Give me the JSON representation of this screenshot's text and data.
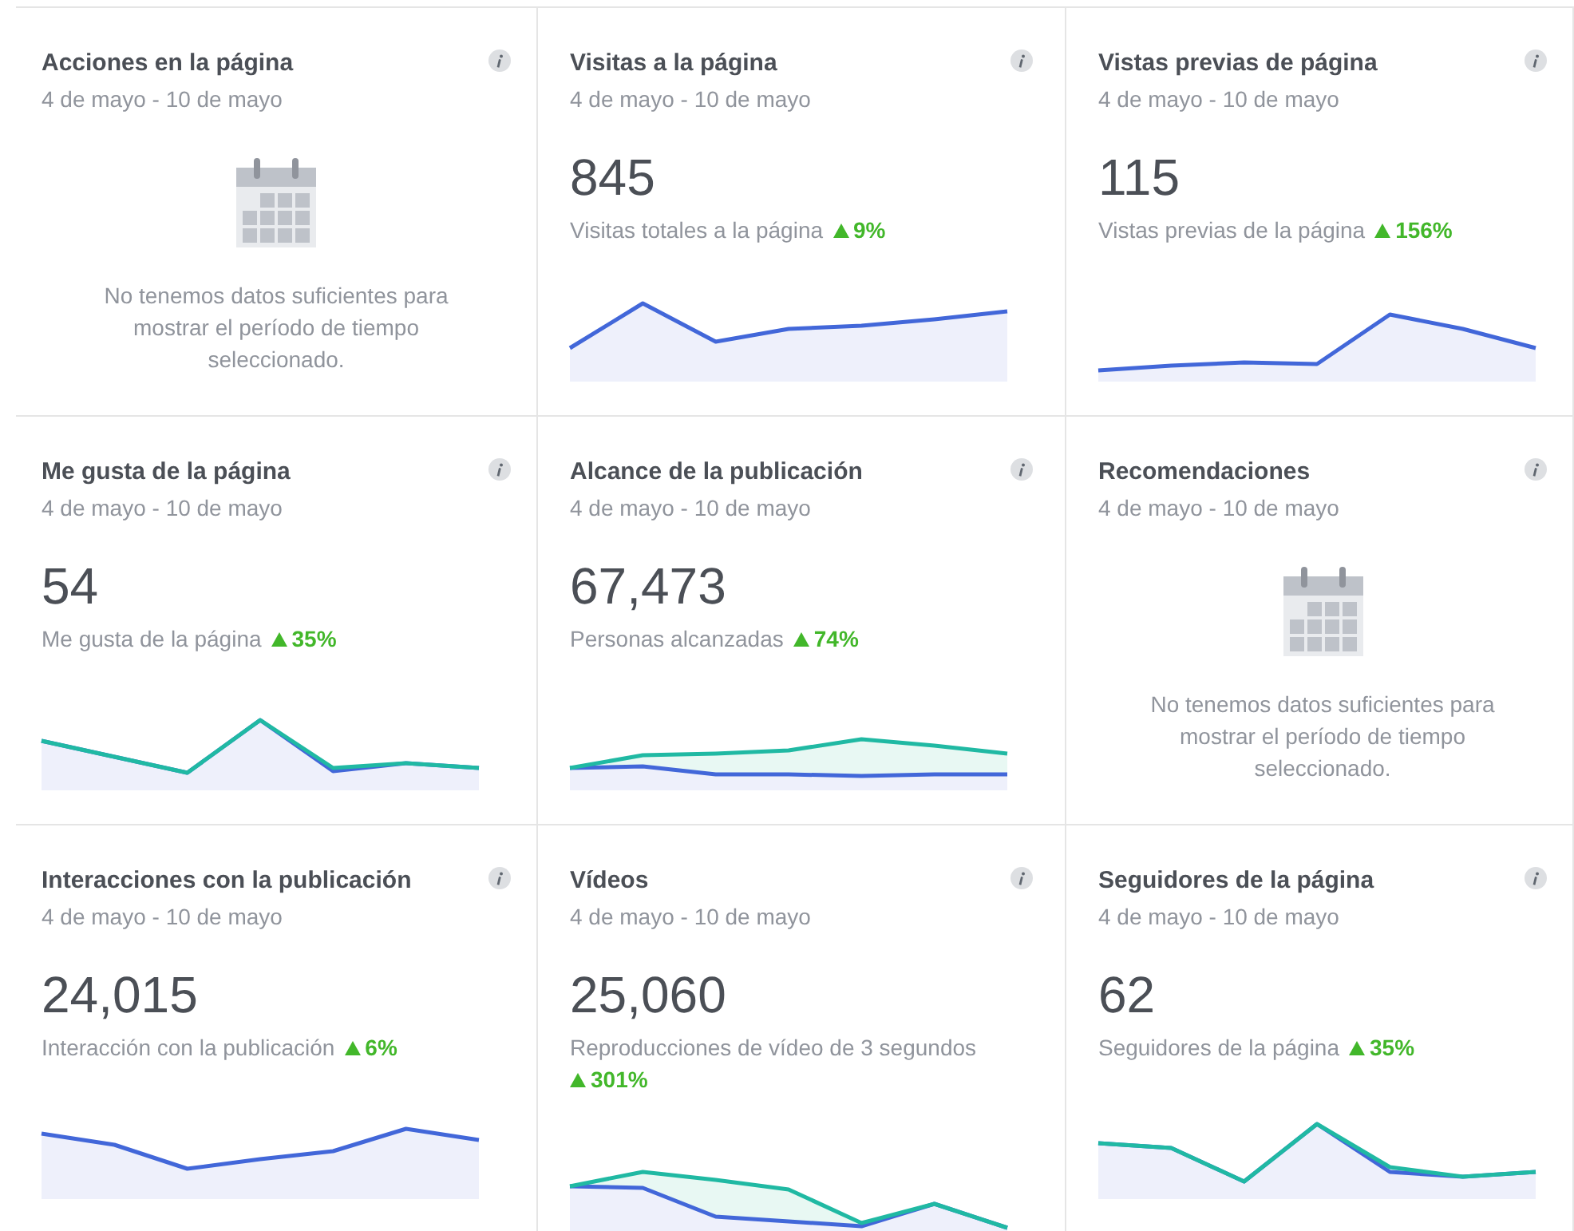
{
  "cards": [
    {
      "kind": "empty",
      "title": "Acciones en la página",
      "date": "4 de mayo - 10 de mayo",
      "message": "No tenemos datos suficientes para mostrar el período de tiempo seleccionado."
    },
    {
      "kind": "metric",
      "title": "Visitas a la página",
      "date": "4 de mayo - 10 de mayo",
      "value": "845",
      "label": "Visitas totales a la página",
      "change": "9%"
    },
    {
      "kind": "metric",
      "title": "Vistas previas de página",
      "date": "4 de mayo - 10 de mayo",
      "value": "115",
      "label": "Vistas previas de la página",
      "change": "156%"
    },
    {
      "kind": "metric",
      "title": "Me gusta de la página",
      "date": "4 de mayo - 10 de mayo",
      "value": "54",
      "label": "Me gusta de la página",
      "change": "35%"
    },
    {
      "kind": "metric",
      "title": "Alcance de la publicación",
      "date": "4 de mayo - 10 de mayo",
      "value": "67,473",
      "label": "Personas alcanzadas",
      "change": "74%"
    },
    {
      "kind": "empty",
      "title": "Recomendaciones",
      "date": "4 de mayo - 10 de mayo",
      "message": "No tenemos datos suficientes para mostrar el período de tiempo seleccionado."
    },
    {
      "kind": "metric",
      "title": "Interacciones con la publicación",
      "date": "4 de mayo - 10 de mayo",
      "value": "24,015",
      "label": "Interacción con la publicación",
      "change": "6%"
    },
    {
      "kind": "metric",
      "title": "Vídeos",
      "date": "4 de mayo - 10 de mayo",
      "value": "25,060",
      "label": "Reproducciones de vídeo de 3 segundos",
      "change": "301%"
    },
    {
      "kind": "metric",
      "title": "Seguidores de la página",
      "date": "4 de mayo - 10 de mayo",
      "value": "62",
      "label": "Seguidores de la página",
      "change": "35%"
    }
  ]
}
